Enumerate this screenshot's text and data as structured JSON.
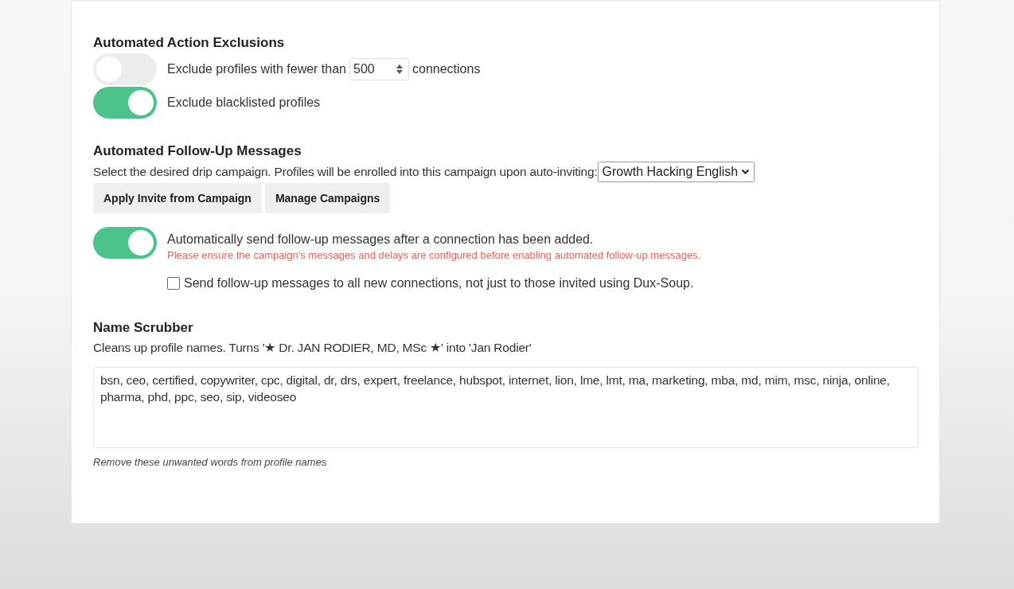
{
  "exclusions": {
    "heading": "Automated Action Exclusions",
    "rows": [
      {
        "kind": "number",
        "on": false,
        "before": "Exclude profiles with fewer than",
        "value": "500",
        "after": "connections"
      },
      {
        "kind": "plain",
        "on": true,
        "label": "Exclude blacklisted profiles"
      }
    ]
  },
  "follow_up": {
    "heading": "Automated Follow-Up Messages",
    "description": "Select the desired drip campaign. Profiles will be enrolled into this campaign upon auto-inviting:",
    "campaign": "Growth Hacking English",
    "buttons": [
      "Apply Invite from Campaign",
      "Manage Campaigns"
    ],
    "auto_send": {
      "on": true,
      "label": "Automatically send follow-up messages after a connection has been added.",
      "warning": "Please ensure the campaign's messages and delays are configured before enabling automated follow-up messages."
    },
    "all_connections": {
      "checked": false,
      "label": "Send follow-up messages to all new connections, not just to those invited using Dux-Soup."
    }
  },
  "name_scrubber": {
    "heading": "Name Scrubber",
    "description": "Cleans up profile names. Turns '★ Dr. JAN RODIER, MD, MSc ★' into 'Jan Rodier'",
    "words": "bsn, ceo, certified, copywriter, cpc, digital, dr, drs, expert, freelance, hubspot, internet, lion, lme, lmt, ma, marketing, mba, md, mim, msc, ninja, online, pharma, phd, ppc, seo, sip, videoseo",
    "hint": "Remove these unwanted words from profile names"
  }
}
